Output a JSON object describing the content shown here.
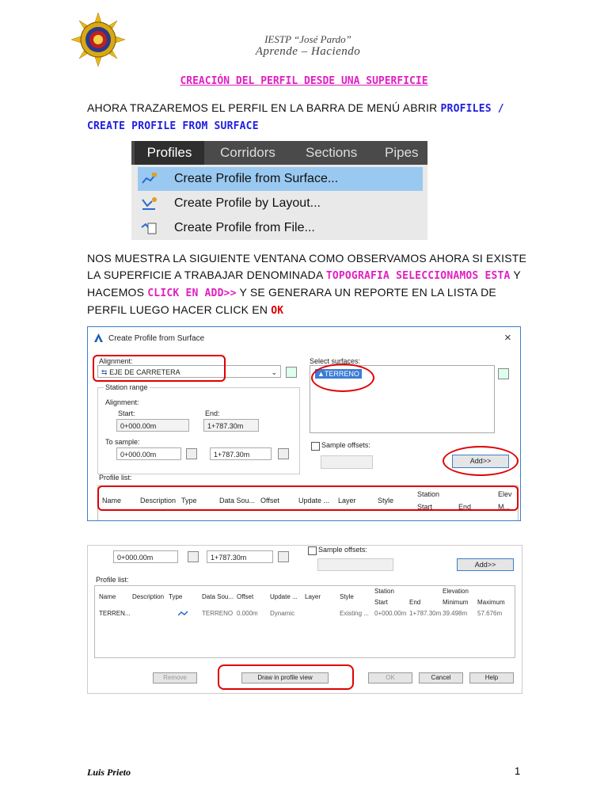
{
  "header": {
    "institution": "IESTP “José Pardo”",
    "motto": "Aprende – Haciendo"
  },
  "title": "CREACIÓN DEL PERFIL DESDE UNA SUPERFICIE",
  "para1": {
    "text1": "AHORA TRAZAREMOS EL PERFIL EN LA BARRA DE MENÚ ABRIR ",
    "highlight1": "PROFILES / CREATE PROFILE FROM SURFACE"
  },
  "menu": {
    "tabs": [
      "Profiles",
      "Corridors",
      "Sections",
      "Pipes"
    ],
    "items": [
      "Create Profile from Surface...",
      "Create Profile by Layout...",
      "Create Profile from File..."
    ]
  },
  "para2": {
    "text1": "NOS MUESTRA LA SIGUIENTE VENTANA COMO OBSERVAMOS AHORA SI EXISTE LA SUPERFICIE A TRABAJAR DENOMINADA ",
    "hl1": "TOPOGRAFIA SELECCIONAMOS ESTA",
    "text2": " Y HACEMOS ",
    "hl2": "CLICK EN ADD>>",
    "text3": " Y SE GENERARA UN REPORTE EN LA LISTA DE PERFIL  LUEGO HACER CLICK EN ",
    "hl3": "OK"
  },
  "dialog1": {
    "title": "Create Profile from Surface",
    "close": "×",
    "alignment_label": "Alignment:",
    "alignment_value": "EJE DE CARRETERA",
    "station_range": "Station range",
    "alignment_sub": "Alignment:",
    "start_label": "Start:",
    "end_label": "End:",
    "start_value": "0+000.00m",
    "end_value": "1+787.30m",
    "to_sample": "To sample:",
    "sample_start": "0+000.00m",
    "sample_end": "1+787.30m",
    "select_surfaces": "Select surfaces:",
    "surface_item": "TERRENO",
    "sample_offsets": "Sample offsets:",
    "add_button": "Add>>",
    "profile_list": "Profile list:",
    "columns": [
      "Name",
      "Description",
      "Type",
      "Data Sou...",
      "Offset",
      "Update ...",
      "Layer",
      "Style",
      "Station",
      "Start",
      "End",
      "Elev",
      "M..."
    ]
  },
  "dialog2": {
    "start_value": "0+000.00m",
    "end_value": "1+787.30m",
    "sample_offsets": "Sample offsets:",
    "add_button": "Add>>",
    "profile_list": "Profile list:",
    "columns": [
      "Name",
      "Description",
      "Type",
      "Data Sou...",
      "Offset",
      "Update ...",
      "Layer",
      "Style",
      "Station",
      "Start",
      "End",
      "Elevation",
      "Minimum",
      "Maximum"
    ],
    "row": [
      "TERREN...",
      "",
      "",
      "TERRENO",
      "0.000m",
      "Dynamic",
      "",
      "Existing ...",
      "",
      "0+000.00m",
      "1+787.30m",
      "39.498m",
      "57.676m"
    ],
    "buttons": [
      "Remove",
      "Draw in profile view",
      "OK",
      "Cancel",
      "Help"
    ]
  },
  "footer": {
    "author": "Luis Prieto",
    "page": "1"
  }
}
